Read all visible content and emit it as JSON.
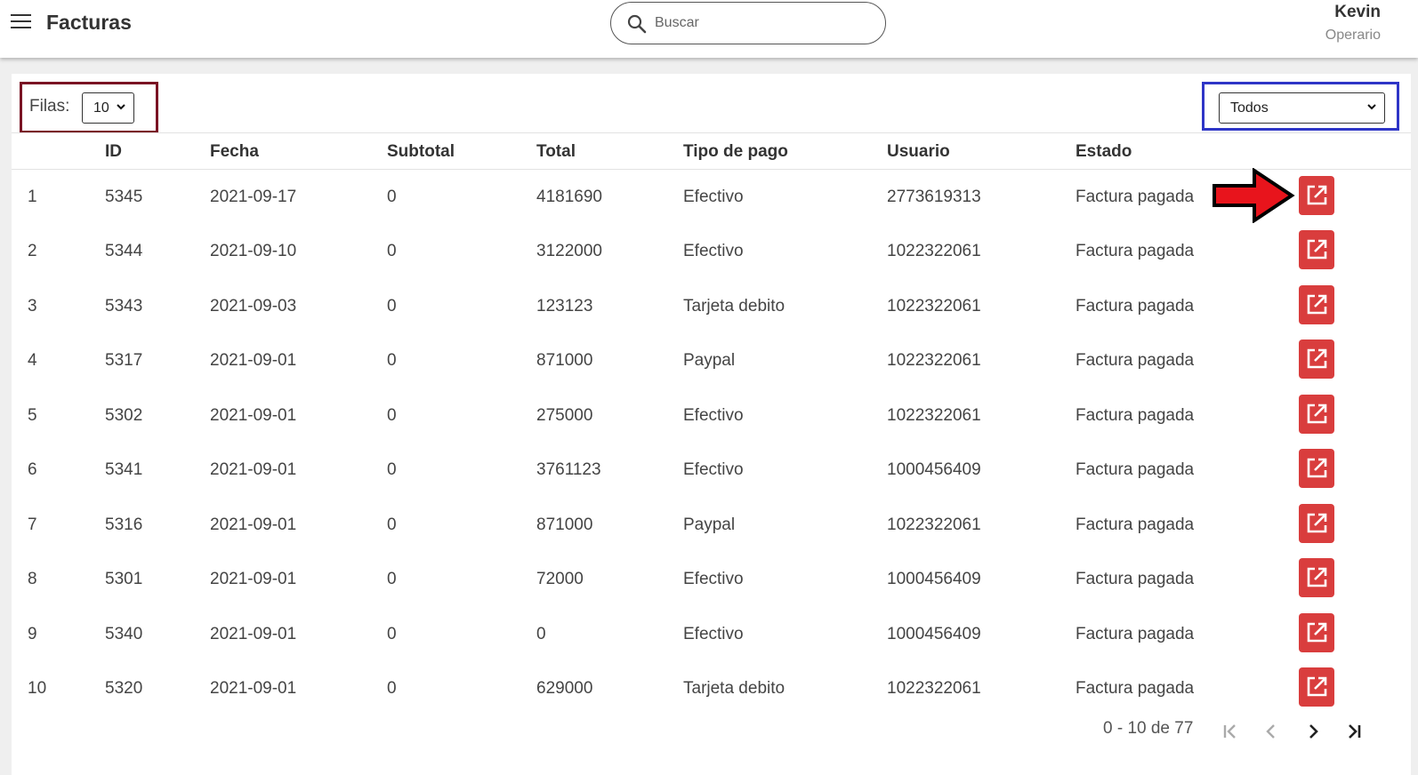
{
  "header": {
    "title": "Facturas",
    "search_placeholder": "Buscar",
    "user_name": "Kevin",
    "user_role": "Operario"
  },
  "controls": {
    "rows_label": "Filas:",
    "rows_value": "10",
    "filter_value": "Todos"
  },
  "table": {
    "columns": [
      "",
      "ID",
      "Fecha",
      "Subtotal",
      "Total",
      "Tipo de pago",
      "Usuario",
      "Estado"
    ],
    "rows": [
      [
        "1",
        "5345",
        "2021-09-17",
        "0",
        "4181690",
        "Efectivo",
        "2773619313",
        "Factura pagada"
      ],
      [
        "2",
        "5344",
        "2021-09-10",
        "0",
        "3122000",
        "Efectivo",
        "1022322061",
        "Factura pagada"
      ],
      [
        "3",
        "5343",
        "2021-09-03",
        "0",
        "123123",
        "Tarjeta debito",
        "1022322061",
        "Factura pagada"
      ],
      [
        "4",
        "5317",
        "2021-09-01",
        "0",
        "871000",
        "Paypal",
        "1022322061",
        "Factura pagada"
      ],
      [
        "5",
        "5302",
        "2021-09-01",
        "0",
        "275000",
        "Efectivo",
        "1022322061",
        "Factura pagada"
      ],
      [
        "6",
        "5341",
        "2021-09-01",
        "0",
        "3761123",
        "Efectivo",
        "1000456409",
        "Factura pagada"
      ],
      [
        "7",
        "5316",
        "2021-09-01",
        "0",
        "871000",
        "Paypal",
        "1022322061",
        "Factura pagada"
      ],
      [
        "8",
        "5301",
        "2021-09-01",
        "0",
        "72000",
        "Efectivo",
        "1000456409",
        "Factura pagada"
      ],
      [
        "9",
        "5340",
        "2021-09-01",
        "0",
        "0",
        "Efectivo",
        "1000456409",
        "Factura pagada"
      ],
      [
        "10",
        "5320",
        "2021-09-01",
        "0",
        "629000",
        "Tarjeta debito",
        "1022322061",
        "Factura pagada"
      ]
    ]
  },
  "pagination": {
    "range_text": "0 - 10 de 77"
  },
  "icons": {
    "menu": "menu-icon",
    "search": "search-icon",
    "edit": "open-in-new-icon",
    "first": "first-page-icon",
    "prev": "chevron-left-icon",
    "next": "chevron-right-icon",
    "last": "last-page-icon"
  },
  "colors": {
    "edit_button": "#d93d3d",
    "rows_highlight": "#7a1424",
    "filter_highlight": "#2e35c7",
    "arrow": "#e8141c"
  }
}
